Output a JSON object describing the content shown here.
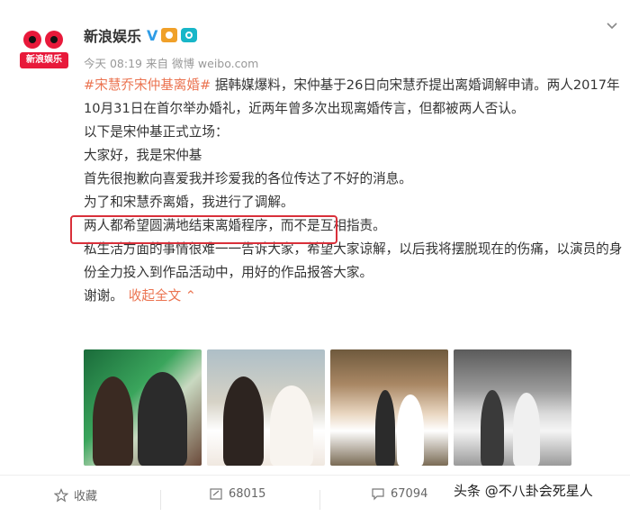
{
  "post": {
    "username": "新浪娱乐",
    "verified_badge": "V",
    "avatar_badge_text": "新浪娱乐",
    "meta": "今天 08:19 来自 微博 weibo.com",
    "topic": "#宋慧乔宋仲基离婚#",
    "lines": [
      " 据韩媒爆料，宋仲基于26日向宋慧乔提出离婚调解申请。两人2017年10月31日在首尔举办婚礼，近两年曾多次出现离婚传言，但都被两人否认。",
      "以下是宋仲基正式立场：",
      "大家好，我是宋仲基",
      "首先很抱歉向喜爱我并珍爱我的各位传达了不好的消息。",
      "为了和宋慧乔离婚，我进行了调解。",
      "两人都希望圆满地结束离婚程序，而不是互相指责。",
      "私生活方面的事情很难一一告诉大家，希望大家谅解，以后我将摆脱现在的伤痛，以演员的身份全力投入到作品活动中，用好的作品报答大家。"
    ],
    "closing": "谢谢。",
    "collapse_label": "收起全文 ⌃"
  },
  "footer": {
    "favorite_label": "收藏",
    "repost_count": "68015",
    "comment_count": "67094"
  },
  "watermark": "头条 @不八卦会死星人",
  "colors": {
    "accent": "#eb7350",
    "highlight_box": "#d9303a",
    "verified": "#2f9ce6"
  },
  "icons": [
    "star-icon",
    "repost-icon",
    "comment-icon",
    "chevron-down-icon"
  ]
}
